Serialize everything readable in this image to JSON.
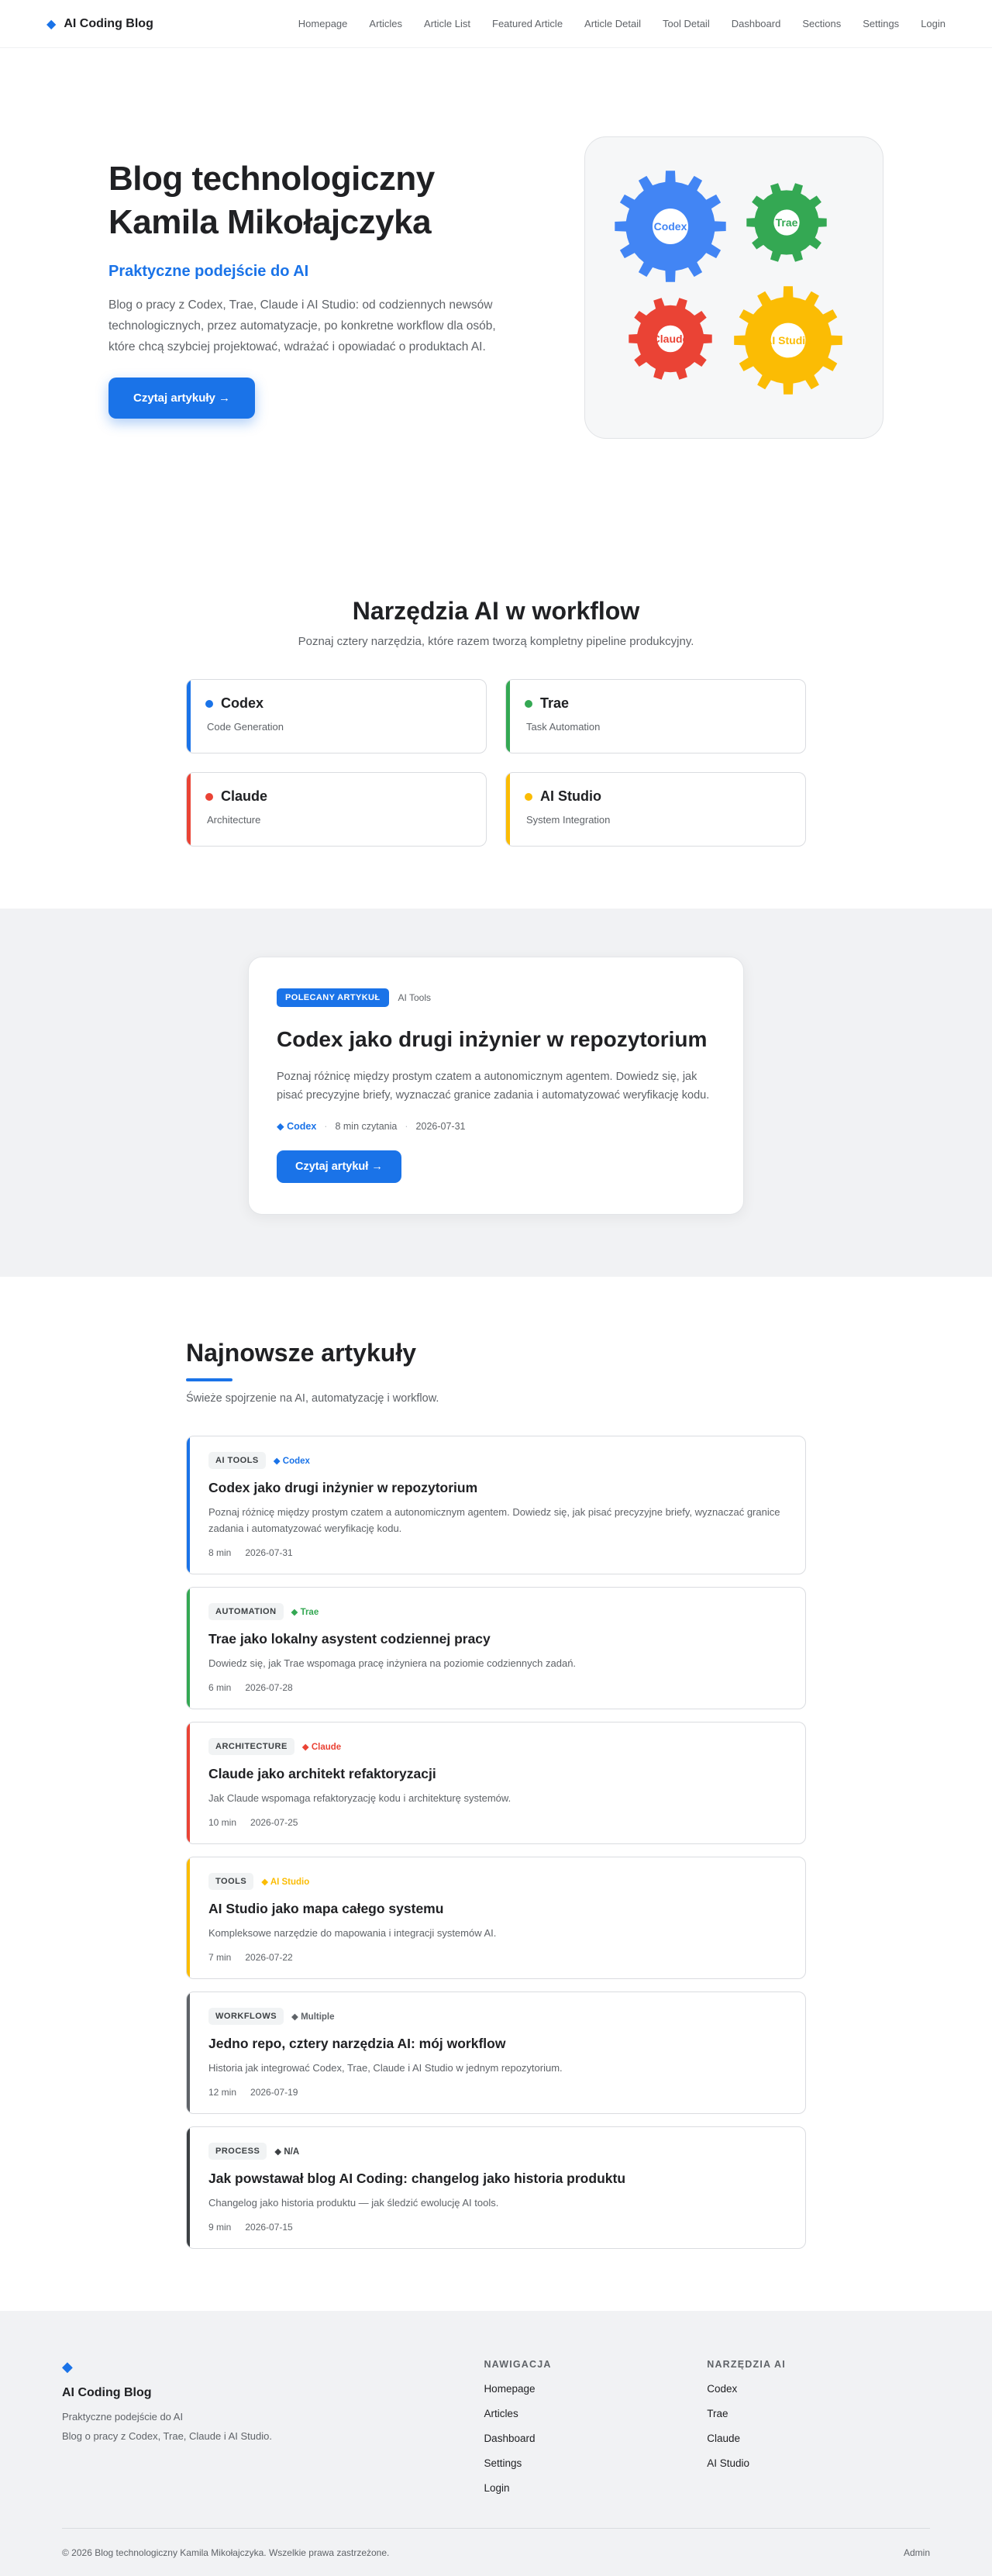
{
  "nav": {
    "brand": "AI Coding Blog",
    "links": [
      "Homepage",
      "Articles",
      "Article List",
      "Featured Article",
      "Article Detail",
      "Tool Detail",
      "Dashboard",
      "Sections",
      "Settings",
      "Login"
    ]
  },
  "hero": {
    "title_line1": "Blog technologiczny",
    "title_line2": "Kamila Mikołajczyka",
    "subtitle": "Praktyczne podejście do AI",
    "description": "Blog o pracy z Codex, Trae, Claude i AI Studio: od codziennych newsów technologicznych, przez automatyzacje, po konkretne workflow dla osób, które chcą szybciej projektować, wdrażać i opowiadać o produktach AI.",
    "cta": "Czytaj artykuły →",
    "gears": [
      {
        "label": "Codex",
        "color": "#4285f4"
      },
      {
        "label": "Trae",
        "color": "#34a853"
      },
      {
        "label": "Claude",
        "color": "#ea4335"
      },
      {
        "label": "AI Studio",
        "color": "#fbbc04"
      }
    ]
  },
  "tools": {
    "title": "Narzędzia AI w workflow",
    "subtitle": "Poznaj cztery narzędzia, które razem tworzą kompletny pipeline produkcyjny.",
    "items": [
      {
        "name": "Codex",
        "desc": "Code Generation",
        "color": "#1a73e8"
      },
      {
        "name": "Trae",
        "desc": "Task Automation",
        "color": "#34a853"
      },
      {
        "name": "Claude",
        "desc": "Architecture",
        "color": "#ea4335"
      },
      {
        "name": "AI Studio",
        "desc": "System Integration",
        "color": "#fbbc04"
      }
    ]
  },
  "featured": {
    "badge": "POLECANY ARTYKUŁ",
    "category": "AI Tools",
    "title": "Codex jako drugi inżynier w repozytorium",
    "description": "Poznaj różnicę między prostym czatem a autonomicznym agentem. Dowiedz się, jak pisać precyzyjne briefy, wyznaczać granice zadania i automatyzować weryfikację kodu.",
    "tool": "◆ Codex",
    "read_time": "8 min czytania",
    "date": "2026-07-31",
    "cta": "Czytaj artykuł →"
  },
  "latest": {
    "title": "Najnowsze artykuły",
    "subtitle": "Świeże spojrzenie na AI, automatyzację i workflow.",
    "articles": [
      {
        "category": "AI TOOLS",
        "tool": "◆ Codex",
        "color": "#1a73e8",
        "title": "Codex jako drugi inżynier w repozytorium",
        "desc": "Poznaj różnicę między prostym czatem a autonomicznym agentem. Dowiedz się, jak pisać precyzyjne briefy, wyznaczać granice zadania i automatyzować weryfikację kodu.",
        "time": "8 min",
        "date": "2026-07-31"
      },
      {
        "category": "AUTOMATION",
        "tool": "◆ Trae",
        "color": "#34a853",
        "title": "Trae jako lokalny asystent codziennej pracy",
        "desc": "Dowiedz się, jak Trae wspomaga pracę inżyniera na poziomie codziennych zadań.",
        "time": "6 min",
        "date": "2026-07-28"
      },
      {
        "category": "ARCHITECTURE",
        "tool": "◆ Claude",
        "color": "#ea4335",
        "title": "Claude jako architekt refaktoryzacji",
        "desc": "Jak Claude wspomaga refaktoryzację kodu i architekturę systemów.",
        "time": "10 min",
        "date": "2026-07-25"
      },
      {
        "category": "TOOLS",
        "tool": "◆ AI Studio",
        "color": "#fbbc04",
        "title": "AI Studio jako mapa całego systemu",
        "desc": "Kompleksowe narzędzie do mapowania i integracji systemów AI.",
        "time": "7 min",
        "date": "2026-07-22"
      },
      {
        "category": "WORKFLOWS",
        "tool": "◆ Multiple",
        "color": "#5f6368",
        "title": "Jedno repo, cztery narzędzia AI: mój workflow",
        "desc": "Historia jak integrować Codex, Trae, Claude i AI Studio w jednym repozytorium.",
        "time": "12 min",
        "date": "2026-07-19"
      },
      {
        "category": "PROCESS",
        "tool": "◆ N/A",
        "color": "#3c4043",
        "title": "Jak powstawał blog AI Coding: changelog jako historia produktu",
        "desc": "Changelog jako historia produktu — jak śledzić ewolucję AI tools.",
        "time": "9 min",
        "date": "2026-07-15"
      }
    ]
  },
  "footer": {
    "brand": "AI Coding Blog",
    "tagline": "Praktyczne podejście do AI",
    "description": "Blog o pracy z Codex, Trae, Claude i AI Studio.",
    "nav_heading": "NAWIGACJA",
    "nav_links": [
      "Homepage",
      "Articles",
      "Dashboard",
      "Settings",
      "Login"
    ],
    "tools_heading": "NARZĘDZIA AI",
    "tool_links": [
      "Codex",
      "Trae",
      "Claude",
      "AI Studio"
    ],
    "copyright": "© 2026 Blog technologiczny Kamila Mikołajczyka. Wszelkie prawa zastrzeżone.",
    "admin": "Admin"
  }
}
